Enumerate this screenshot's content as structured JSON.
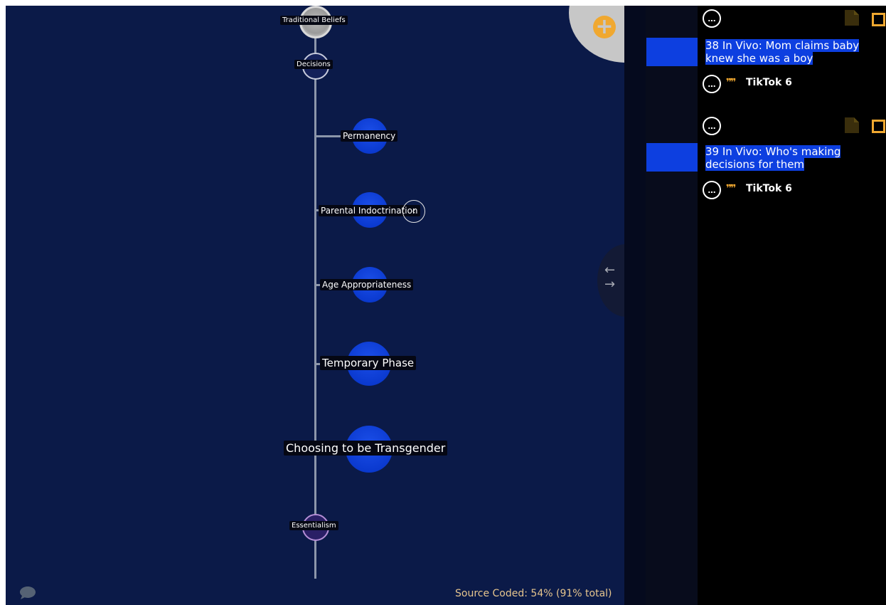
{
  "tree": {
    "nodes": {
      "traditional_beliefs": "Traditional Beliefs",
      "decisions": "Decisions",
      "permanency": "Permanency",
      "parental_indoctrination": "Parental Indoctrination",
      "age_appropriateness": "Age Appropriateness",
      "temporary_phase": "Temporary Phase",
      "choosing_to_be_transgender": "Choosing to be Transgender",
      "essentialism": "Essentialism"
    },
    "collapse_handle": "‹"
  },
  "toolbar": {
    "add_icon": "plus-icon",
    "add_glyph": "+",
    "swap_glyph_left": "←",
    "swap_glyph_right": "→"
  },
  "status": {
    "source_coded": "Source Coded: 54% (91% total)"
  },
  "codes": [
    {
      "title": "38 In Vivo: Mom claims baby knew she was a boy",
      "source": "TikTok 6"
    },
    {
      "title": "39 In Vivo: Who's making decisions for them",
      "source": "TikTok 6"
    }
  ],
  "glyphs": {
    "ellipsis": "…",
    "quote": "❞❞"
  },
  "colors": {
    "canvas": "#0b1a48",
    "node_blue": "#0b3ad0",
    "accent_orange": "#f0a830",
    "highlight": "#0d3fe0"
  }
}
